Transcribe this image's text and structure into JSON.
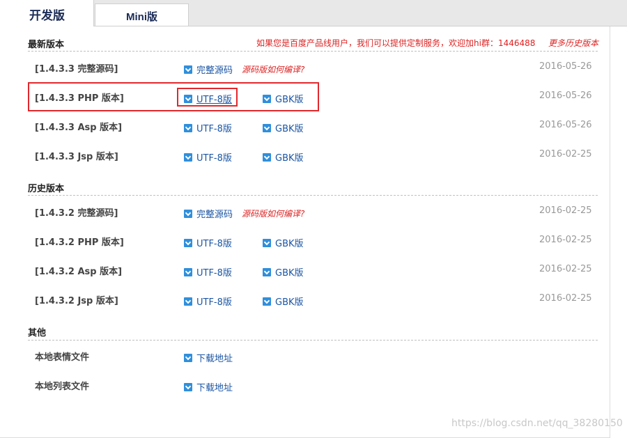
{
  "tabs": {
    "dev": "开发版",
    "mini": "Mini版"
  },
  "notice": {
    "text": "如果您是百度产品线用户，我们可以提供定制服务，欢迎加hi群：1446488",
    "history_link": "更多历史版本"
  },
  "sections": [
    {
      "title": "最新版本",
      "rows": [
        {
          "label": "[1.4.3.3 完整源码]",
          "link1": "完整源码",
          "note": "源码版如何编译?",
          "date": "2016-05-26"
        },
        {
          "label": "[1.4.3.3 PHP 版本]",
          "link1": "UTF-8版",
          "link2": "GBK版",
          "date": "2016-05-26"
        },
        {
          "label": "[1.4.3.3 Asp 版本]",
          "link1": "UTF-8版",
          "link2": "GBK版",
          "date": "2016-05-26"
        },
        {
          "label": "[1.4.3.3 Jsp 版本]",
          "link1": "UTF-8版",
          "link2": "GBK版",
          "date": "2016-02-25"
        }
      ]
    },
    {
      "title": "历史版本",
      "rows": [
        {
          "label": "[1.4.3.2 完整源码]",
          "link1": "完整源码",
          "note": "源码版如何编译?",
          "date": "2016-02-25"
        },
        {
          "label": "[1.4.3.2 PHP 版本]",
          "link1": "UTF-8版",
          "link2": "GBK版",
          "date": "2016-02-25"
        },
        {
          "label": "[1.4.3.2 Asp 版本]",
          "link1": "UTF-8版",
          "link2": "GBK版",
          "date": "2016-02-25"
        },
        {
          "label": "[1.4.3.2 Jsp 版本]",
          "link1": "UTF-8版",
          "link2": "GBK版",
          "date": "2016-02-25"
        }
      ]
    },
    {
      "title": "其他",
      "rows": [
        {
          "label": "本地表情文件",
          "link1": "下载地址"
        },
        {
          "label": "本地列表文件",
          "link1": "下载地址"
        }
      ]
    }
  ],
  "watermark": "https://blog.csdn.net/qq_38280150",
  "colors": {
    "link": "#1b55a3",
    "notice_red": "#dd2222",
    "highlight_border": "#e0282c",
    "download_icon": "#2f8fdc"
  }
}
